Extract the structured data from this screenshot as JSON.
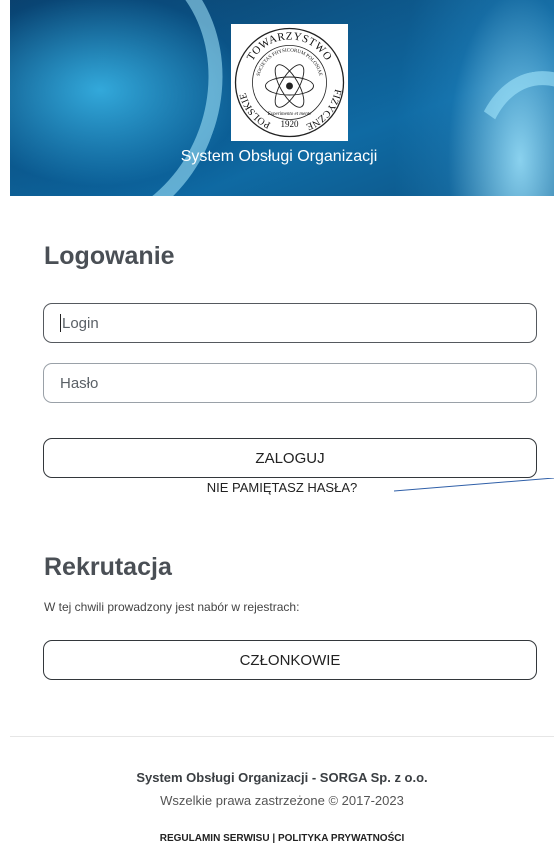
{
  "header": {
    "logo": {
      "top_text": "TOWARZYSTWO",
      "left_text": "POLSKIE",
      "right_text": "FIZYCZNE",
      "inner_text": "SOCIETAS PHYSICORUM POLONIAE",
      "motto": "Experimento et mente",
      "year": "1920"
    },
    "app_title": "System Obsługi Organizacji"
  },
  "login": {
    "heading": "Logowanie",
    "login_placeholder": "Login",
    "password_placeholder": "Hasło",
    "submit_label": "ZALOGUJ",
    "forgot_label": "NIE PAMIĘTASZ HASŁA?"
  },
  "recruitment": {
    "heading": "Rekrutacja",
    "description": "W tej chwili prowadzony jest nabór w rejestrach:",
    "members_button": "CZŁONKOWIE"
  },
  "footer": {
    "company": "System Obsługi Organizacji - SORGA Sp. z o.o.",
    "copyright": "Wszelkie prawa zastrzeżone © 2017-2023",
    "terms_link": "REGULAMIN SERWISU",
    "separator": " | ",
    "privacy_link": "POLITYKA PRYWATNOŚCI"
  },
  "colors": {
    "background_blue": "#0f6aa3",
    "heading_gray": "#4a4f55",
    "annotation_line": "#2f5fa8"
  }
}
